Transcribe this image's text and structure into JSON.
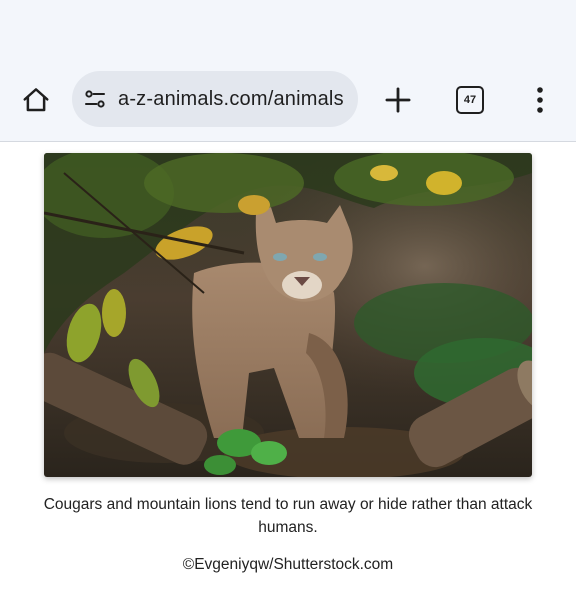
{
  "browser": {
    "url": "a-z-animals.com/animals",
    "tab_count": "47",
    "icons": {
      "home": "home-icon",
      "site_settings": "tune-icon",
      "new_tab": "plus-icon",
      "tabs": "tab-switcher-icon",
      "menu": "more-vert-icon"
    }
  },
  "article": {
    "image_subject": "cougar",
    "caption": "Cougars and mountain lions tend to run away or hide rather than attack humans.",
    "credit": "©Evgeniyqw/Shutterstock.com"
  },
  "colors": {
    "toolbar_bg": "#f3f6fb",
    "omnibox_bg": "#e3e7ee",
    "text": "#222222"
  }
}
